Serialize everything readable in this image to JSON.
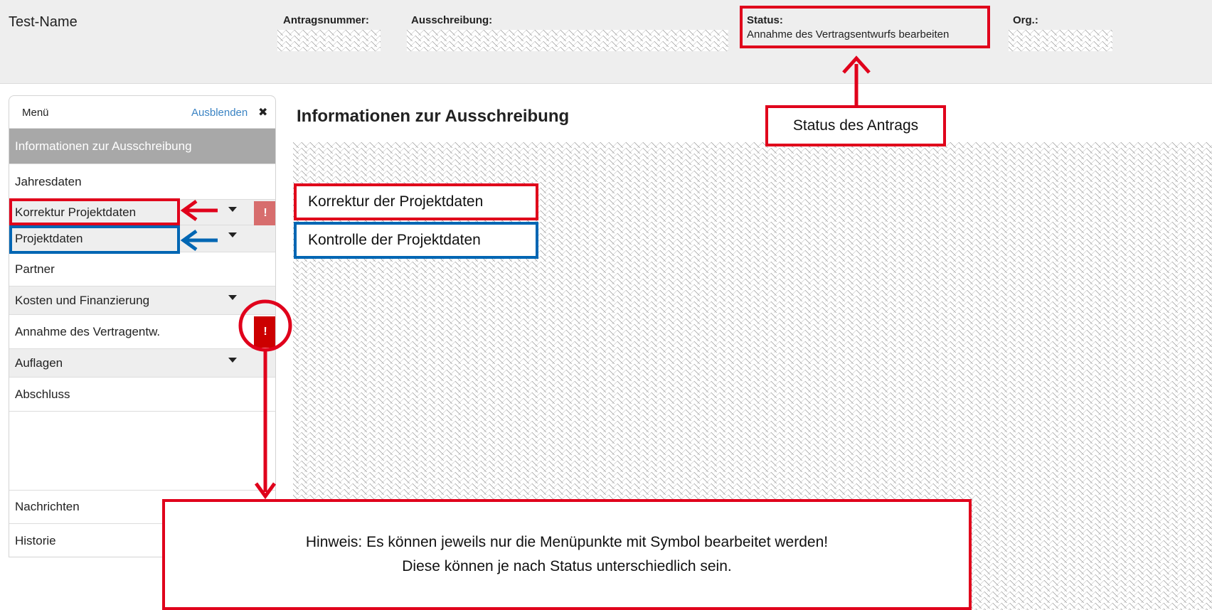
{
  "header": {
    "app_name": "Test-Name",
    "application_number_label": "Antragsnummer:",
    "call_label": "Ausschreibung:",
    "status_label": "Status:",
    "status_value": "Annahme des Vertragsentwurfs bearbeiten",
    "org_label": "Org.:"
  },
  "sidebar": {
    "menu_title": "Menü",
    "hide_label": "Ausblenden",
    "items": [
      {
        "label": "Informationen zur Ausschreibung",
        "state": "active"
      },
      {
        "label": "Jahresdaten"
      },
      {
        "label": "Korrektur Projektdaten",
        "expandable": true,
        "warning": true
      },
      {
        "label": "Projektdaten",
        "expandable": true
      },
      {
        "label": "Partner"
      },
      {
        "label": "Kosten und Finanzierung",
        "expandable": true
      },
      {
        "label": "Annahme des Vertragentw.",
        "warning": true
      },
      {
        "label": "Auflagen",
        "expandable": true
      },
      {
        "label": "Abschluss"
      },
      {
        "label": "Nachrichten"
      },
      {
        "label": "Historie"
      }
    ],
    "warning_symbol": "!"
  },
  "main": {
    "title": "Informationen zur Ausschreibung"
  },
  "annotations": {
    "status_callout": "Status des Antrags",
    "correction_callout": "Korrektur der Projektdaten",
    "control_callout": "Kontrolle der Projektdaten",
    "hint_line1": "Hinweis: Es können jeweils nur die Menüpunkte mit Symbol bearbeitet werden!",
    "hint_line2": "Diese können je nach Status unterschiedlich sein."
  },
  "colors": {
    "annotation_red": "#e0001b",
    "annotation_blue": "#0066b3",
    "warning_red": "#cc0000",
    "warning_light_red": "#d76d6d",
    "link_blue": "#3a83c3"
  },
  "icons": [
    "close-icon",
    "chevron-down-icon",
    "warning-icon",
    "arrow-icon"
  ]
}
